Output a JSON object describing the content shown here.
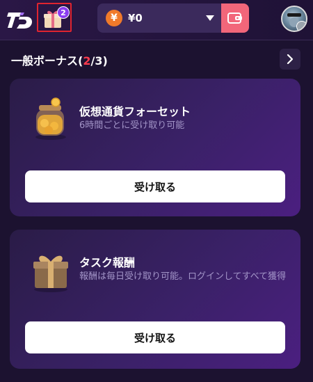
{
  "header": {
    "gift_badge_count": "2",
    "balance": "¥0",
    "currency_symbol": "¥"
  },
  "section": {
    "title": "一般ボーナス",
    "open_paren": "(",
    "count_current": "2",
    "count_sep_total": "/3",
    "close_paren": ")"
  },
  "cards": [
    {
      "title": "仮想通貨フォーセット",
      "subtitle": "6時間ごとに受け取り可能",
      "button_label": "受け取る",
      "icon": "coin-jar-icon"
    },
    {
      "title": "タスク報酬",
      "subtitle": "報酬は毎日受け取り可能。ログインしてすべて獲得",
      "button_label": "受け取る",
      "icon": "gift-box-icon"
    }
  ],
  "colors": {
    "background": "#1c1230",
    "accent_red": "#ff3b4e",
    "wallet_button": "#f2667a",
    "badge_purple": "#8a3df0",
    "subtitle_text": "#a395c8"
  }
}
